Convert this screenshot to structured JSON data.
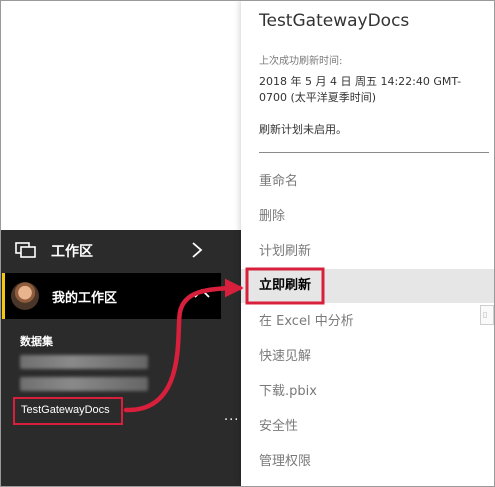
{
  "nav": {
    "workspaces_label": "工作区",
    "my_workspace_label": "我的工作区",
    "datasets_heading": "数据集",
    "selected_dataset": "TestGatewayDocs",
    "more_glyph": "..."
  },
  "panel": {
    "title": "TestGatewayDocs",
    "last_refresh_heading": "上次成功刷新时间:",
    "last_refresh_time": "2018 年 5 月 4 日 周五 14:22:40 GMT-0700 (太平洋夏季时间)",
    "schedule_status": "刷新计划未启用。",
    "menu": [
      {
        "label": "重命名"
      },
      {
        "label": "删除"
      },
      {
        "label": "计划刷新"
      },
      {
        "label": "立即刷新"
      },
      {
        "label": "在 Excel 中分析"
      },
      {
        "label": "快速见解"
      },
      {
        "label": "下载.pbix"
      },
      {
        "label": "安全性"
      },
      {
        "label": "管理权限"
      }
    ],
    "edge_tab_glyph": "▯"
  },
  "colors": {
    "nav_bg": "#2b2b2b",
    "accent_yellow": "#f2c811",
    "annotation_red": "#d8203c",
    "highlight_bg": "#e6e6e6"
  }
}
